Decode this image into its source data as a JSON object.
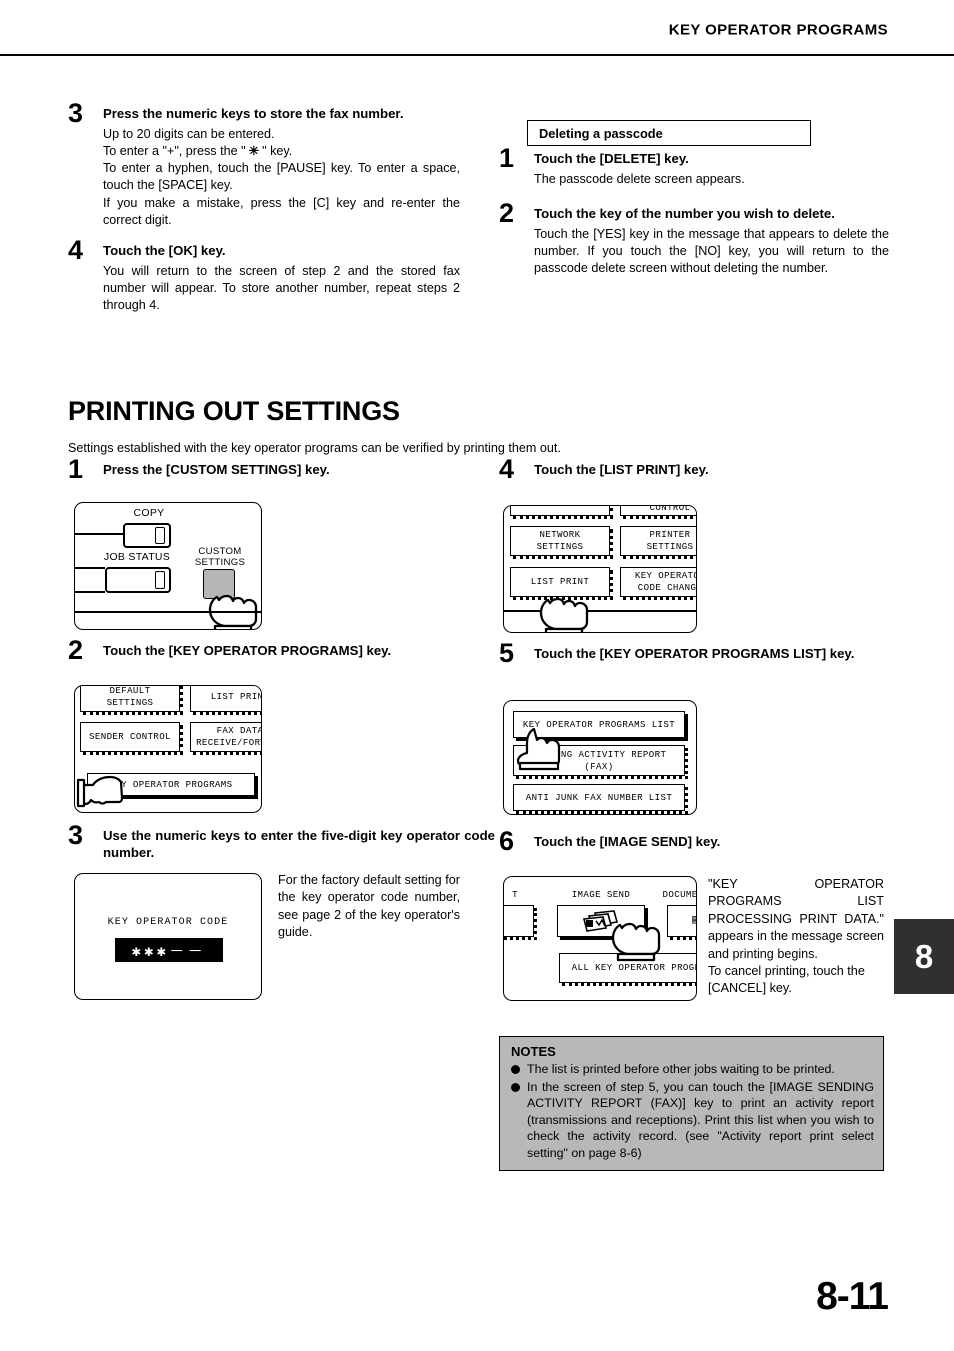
{
  "header": {
    "title": "KEY OPERATOR PROGRAMS"
  },
  "page": {
    "number": "8-11",
    "tab": "8"
  },
  "left_column": {
    "step3": {
      "num": "3",
      "title": "Press the numeric keys to store the fax number.",
      "body_line1": "Up to 20 digits can be entered.",
      "body_line2_a": "To enter a \"+\", press the \"",
      "body_line2_star": "✳",
      "body_line2_b": "\" key.",
      "body_line3": "To enter a hyphen, touch the [PAUSE] key. To enter a space, touch the [SPACE] key.",
      "body_line4": "If you make a mistake, press the [C] key and re-enter the correct digit."
    },
    "step4": {
      "num": "4",
      "title": "Touch the [OK] key.",
      "body": "You will return to the screen of step 2 and the stored fax number will appear. To store another number, repeat steps 2 through 4."
    }
  },
  "right_column": {
    "subtitle": "Deleting a passcode",
    "step1": {
      "num": "1",
      "title": "Touch the [DELETE] key.",
      "body": "The passcode delete screen appears."
    },
    "step2": {
      "num": "2",
      "title": "Touch the key of the number you wish to delete.",
      "body": "Touch the [YES] key in the message that appears to delete the number. If you touch the [NO] key, you will return to the passcode delete screen without deleting the number."
    }
  },
  "section": {
    "heading": "PRINTING OUT SETTINGS",
    "intro": "Settings established with the key operator programs can be verified by printing them out."
  },
  "procedure": {
    "step1": {
      "num": "1",
      "title": "Press the [CUSTOM SETTINGS] key.",
      "panel": {
        "copy_label": "COPY",
        "job_status_label": "JOB  STATUS",
        "custom_settings_label_line1": "CUSTOM",
        "custom_settings_label_line2": "SETTINGS"
      }
    },
    "step2": {
      "num": "2",
      "title": "Touch the [KEY OPERATOR PROGRAMS] key.",
      "panel": {
        "btn_default_settings_line1": "DEFAULT",
        "btn_default_settings_line2": "SETTINGS",
        "btn_list_print": "LIST PRINT",
        "btn_sender_control": "SENDER CONTROL",
        "btn_fax_data_line1": "FAX DATA",
        "btn_fax_data_line2": "RECEIVE/FORWARD",
        "btn_key_operator_programs": "KEY OPERATOR PROGRAMS"
      }
    },
    "step3": {
      "num": "3",
      "title": "Use the numeric keys to enter the five-digit key operator code number.",
      "panel": {
        "caption": "KEY OPERATOR CODE",
        "code_value": "✱✱✱－－"
      },
      "side_text": "For the factory default setting for the key operator code number, see page 2 of the key operator's guide."
    },
    "step4": {
      "num": "4",
      "title": "Touch the [LIST PRINT] key.",
      "panel": {
        "btn_partial_top_right": "CONTROL",
        "btn_network_settings_line1": "NETWORK",
        "btn_network_settings_line2": "SETTINGS",
        "btn_printer_settings_line1": "PRINTER",
        "btn_printer_settings_line2": "SETTINGS",
        "btn_list_print": "LIST PRINT",
        "btn_key_operator_code_line1": "KEY OPERATOR",
        "btn_key_operator_code_line2": "CODE CHANGE"
      }
    },
    "step5": {
      "num": "5",
      "title": "Touch the [KEY OPERATOR PROGRAMS LIST] key.",
      "panel": {
        "btn_key_operator_programs_list": "KEY OPERATOR PROGRAMS LIST",
        "btn_sending_activity_line1": "SENDING ACTIVITY REPORT",
        "btn_sending_activity_line2": "(FAX)",
        "btn_anti_junk": "ANTI JUNK FAX NUMBER LIST"
      }
    },
    "step6": {
      "num": "6",
      "title": "Touch the [IMAGE SEND] key.",
      "panel": {
        "label_left_partial": "T",
        "label_image_send": "IMAGE SEND",
        "label_document_partial": "DOCUMEN",
        "btn_all_key_operator": "ALL KEY OPERATOR PROGRA"
      },
      "side_text": "\"KEY OPERATOR PROGRAMS LIST PROCESSING PRINT DATA.\" appears in the message screen and printing begins.\nTo cancel printing, touch the [CANCEL] key.",
      "side_text_a": "\"KEY OPERATOR PROGRAMS LIST PROCESSING PRINT DATA.\" appears in the message screen and printing begins.",
      "side_text_b": "To cancel printing, touch the [CANCEL] key."
    }
  },
  "notes": {
    "title": "NOTES",
    "items": [
      "The list is printed before other jobs waiting to be printed.",
      "In the screen of step 5, you can touch the [IMAGE SENDING ACTIVITY REPORT (FAX)] key to print an activity report (transmissions and receptions). Print this list when you wish to check the activity record. (see \"Activity report print select setting\" on page 8-6)"
    ]
  }
}
